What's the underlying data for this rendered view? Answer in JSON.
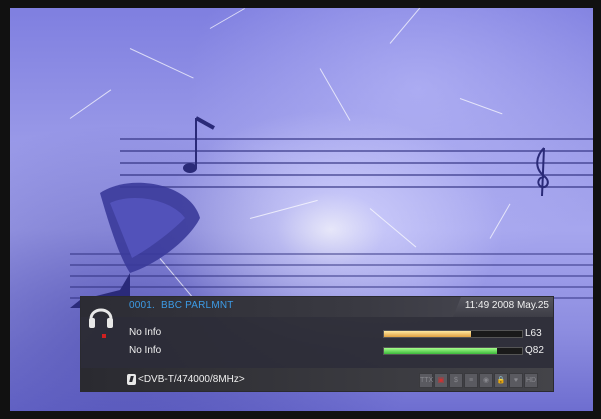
{
  "channel": {
    "number": "0001.",
    "name": "BBC PARLMNT"
  },
  "datetime": "11:49 2008 May.25",
  "epg": {
    "now": "No Info",
    "next": "No Info"
  },
  "signal": {
    "level_label": "L63",
    "level_value": 0.63,
    "quality_label": "Q82",
    "quality_value": 0.82
  },
  "transponder": "<DVB-T/474000/8MHz>",
  "status_flags": [
    {
      "name": "ttx-icon",
      "glyph": "TTX"
    },
    {
      "name": "subtitle-icon",
      "glyph": "▣"
    },
    {
      "name": "dollar-icon",
      "glyph": "$"
    },
    {
      "name": "epg-icon",
      "glyph": "≡"
    },
    {
      "name": "signal-icon",
      "glyph": "◉"
    },
    {
      "name": "lock-icon",
      "glyph": "🔒"
    },
    {
      "name": "favorite-icon",
      "glyph": "♥"
    },
    {
      "name": "hd-icon",
      "glyph": "HD"
    }
  ],
  "icons": {
    "mode": "headphones-icon"
  }
}
